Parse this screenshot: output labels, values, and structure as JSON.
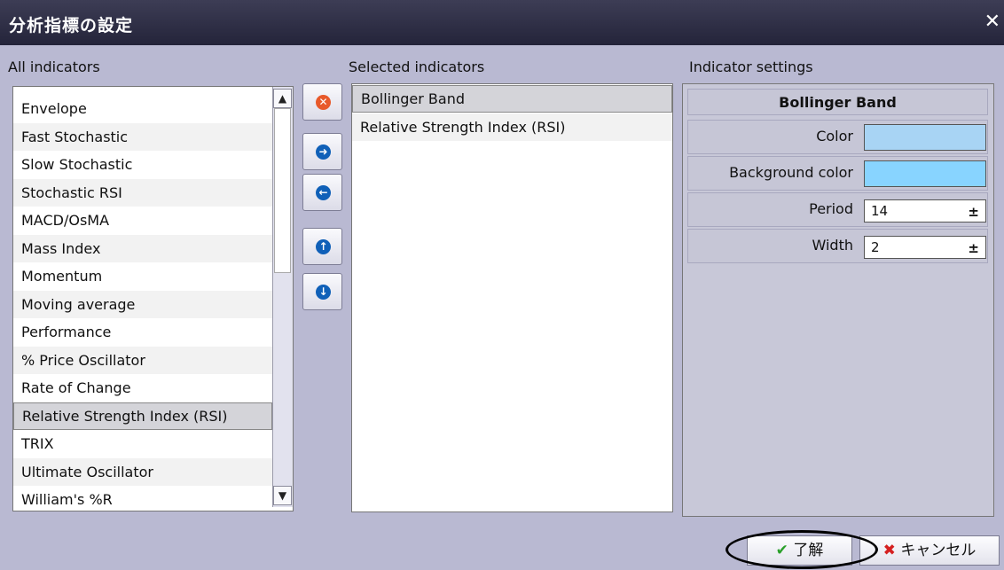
{
  "window": {
    "title": "分析指標の設定",
    "close_icon": "close-icon"
  },
  "labels": {
    "all": "All indicators",
    "selected": "Selected indicators",
    "settings": "Indicator settings"
  },
  "all_indicators": [
    "Envelope",
    "Fast Stochastic",
    "Slow Stochastic",
    "Stochastic RSI",
    "MACD/OsMA",
    "Mass Index",
    "Momentum",
    "Moving average",
    "Performance",
    "% Price Oscillator",
    "Rate of Change",
    "Relative Strength Index (RSI)",
    "TRIX",
    "Ultimate Oscillator",
    "William's %R"
  ],
  "selected_indicators": [
    "Bollinger Band",
    "Relative Strength Index (RSI)"
  ],
  "settings": {
    "header": "Bollinger Band",
    "rows": [
      {
        "label": "Color",
        "color": "#a8d4f4"
      },
      {
        "label": "Background color",
        "color": "#88d4ff"
      },
      {
        "label": "Period",
        "value": "14"
      },
      {
        "label": "Width",
        "value": "2"
      }
    ]
  },
  "buttons": {
    "ok": "了解",
    "cancel": "キャンセル"
  },
  "icons": {
    "remove": "remove-icon",
    "add": "add-icon",
    "back": "arrow-left-icon",
    "up": "move-up-icon",
    "down": "move-down-icon"
  }
}
